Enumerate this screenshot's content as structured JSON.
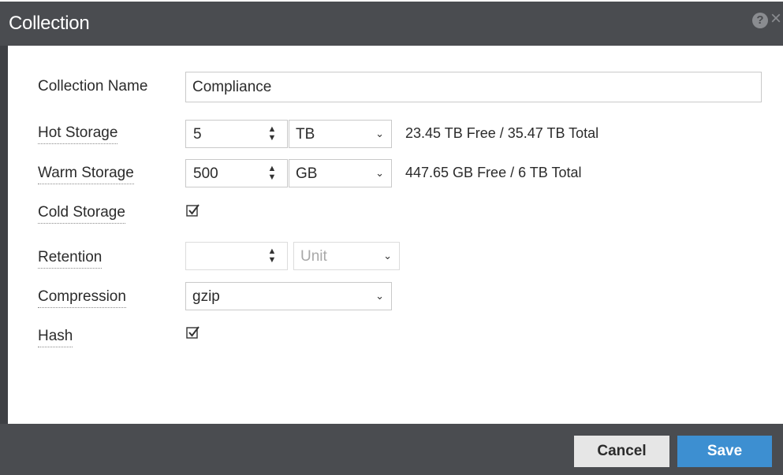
{
  "dialog": {
    "title": "Collection",
    "help_icon": "?",
    "close_icon": "×"
  },
  "fields": {
    "collection_name": {
      "label": "Collection Name",
      "value": "Compliance"
    },
    "hot_storage": {
      "label": "Hot Storage",
      "value": "5",
      "unit": "TB",
      "info": "23.45 TB Free / 35.47 TB Total"
    },
    "warm_storage": {
      "label": "Warm Storage",
      "value": "500",
      "unit": "GB",
      "info": "447.65 GB Free / 6 TB Total"
    },
    "cold_storage": {
      "label": "Cold Storage",
      "checked": true
    },
    "retention": {
      "label": "Retention",
      "value": "",
      "unit": "Unit"
    },
    "compression": {
      "label": "Compression",
      "value": "gzip"
    },
    "hash": {
      "label": "Hash",
      "checked": true
    }
  },
  "buttons": {
    "cancel": "Cancel",
    "save": "Save"
  },
  "colors": {
    "titlebar": "#4a4c50",
    "save_button": "#3d8fd1",
    "cancel_button": "#e6e6e6"
  },
  "icons": {
    "help": "help-icon",
    "close": "close-icon",
    "spinner": "up-down-arrows-icon",
    "dropdown": "chevron-down-icon",
    "checkbox": "checkmark-icon"
  }
}
